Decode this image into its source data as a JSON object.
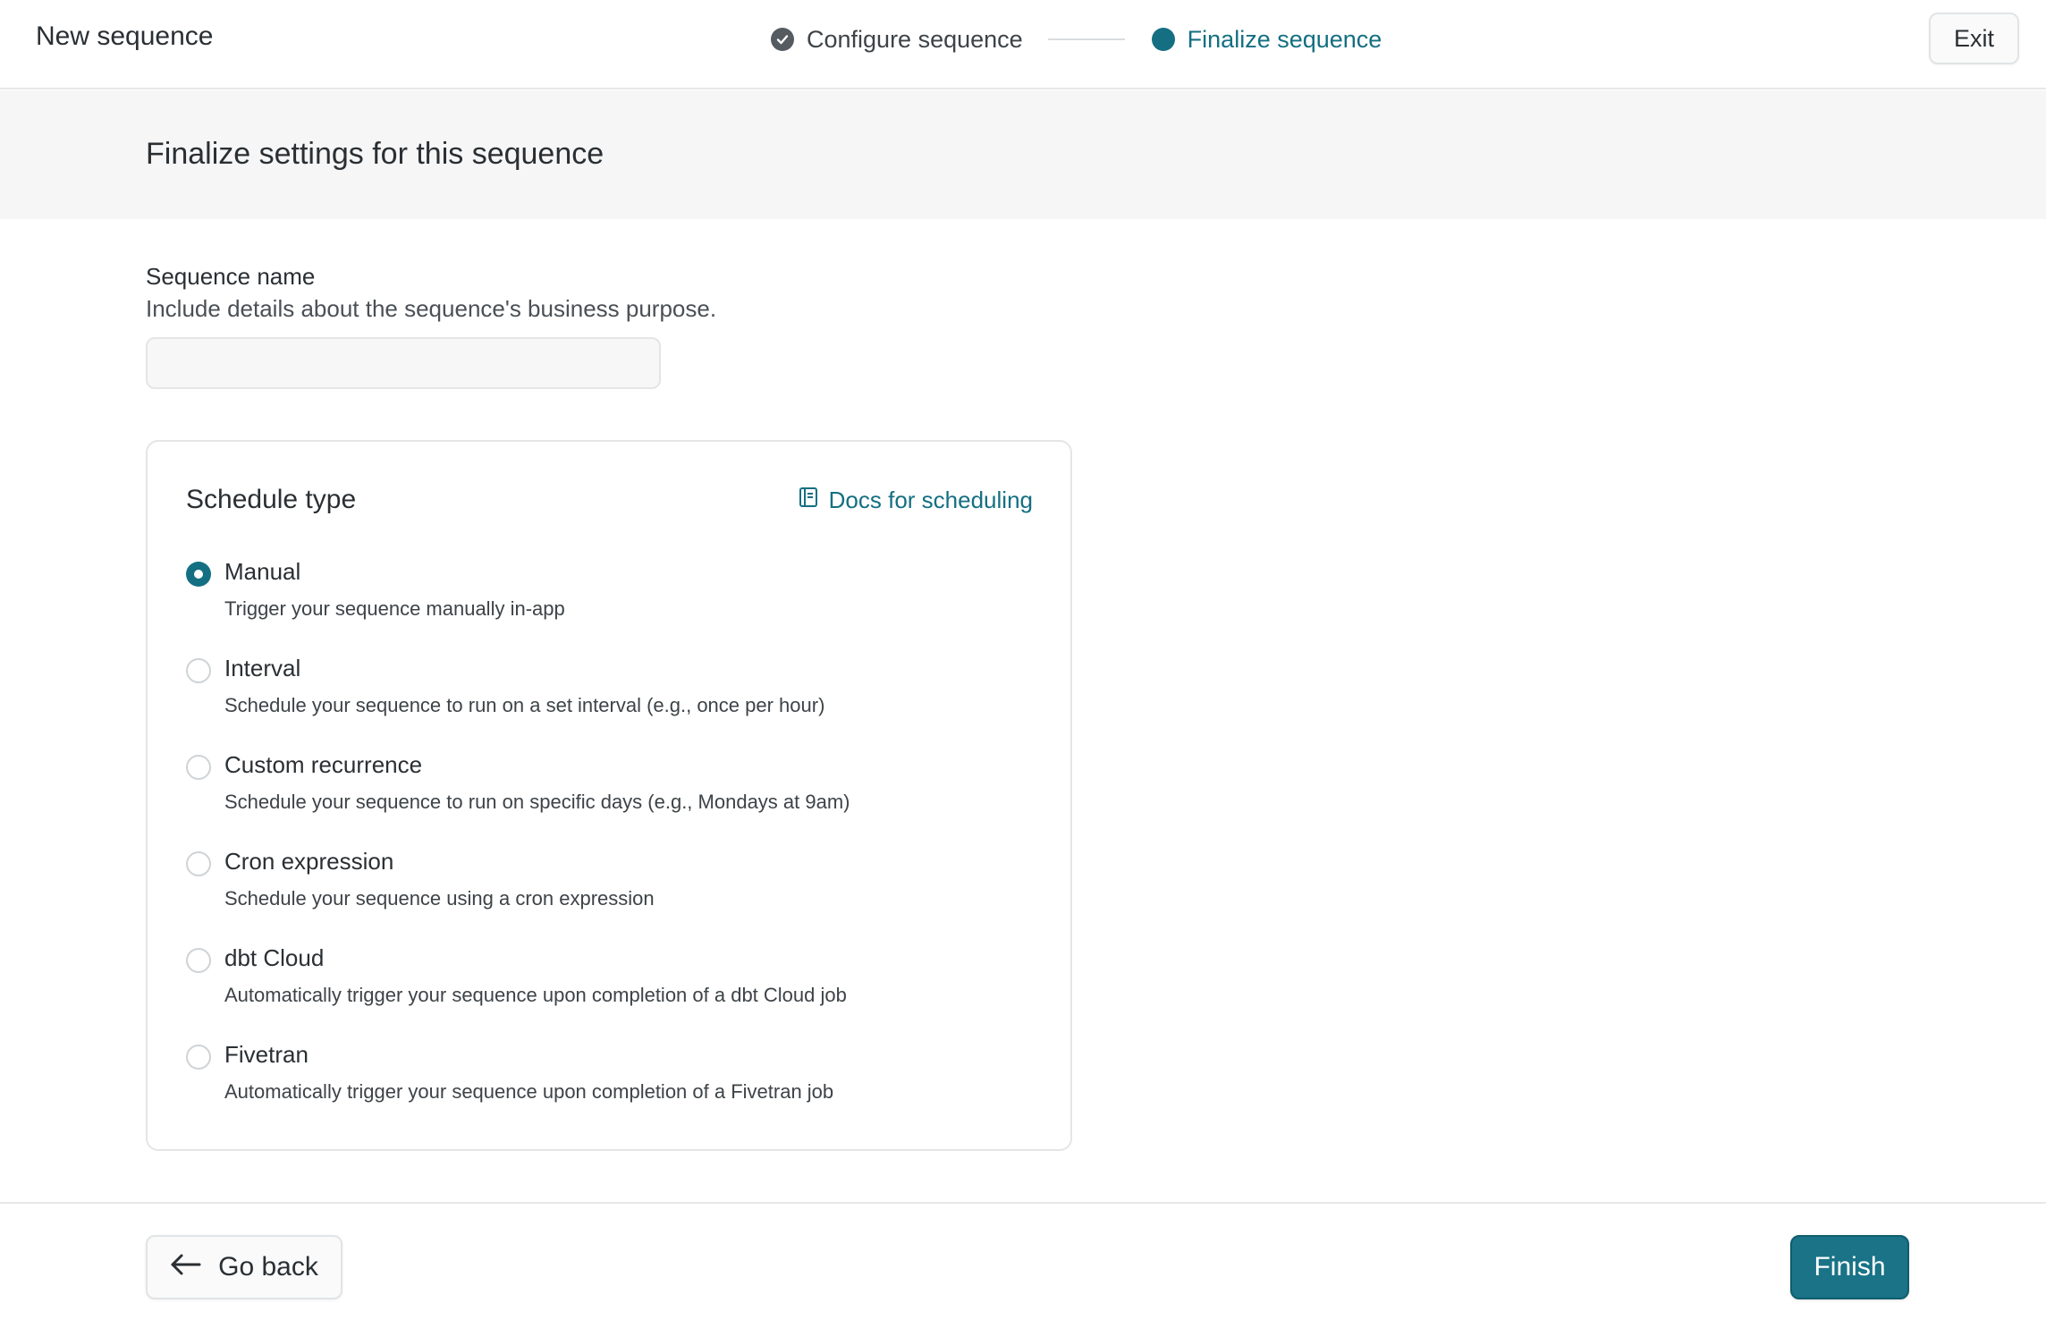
{
  "header": {
    "app_title": "New sequence",
    "steps": [
      {
        "label": "Configure sequence",
        "state": "complete"
      },
      {
        "label": "Finalize sequence",
        "state": "active"
      }
    ],
    "exit_label": "Exit"
  },
  "page": {
    "title": "Finalize settings for this sequence"
  },
  "name_field": {
    "label": "Sequence name",
    "help": "Include details about the sequence's business purpose.",
    "value": "",
    "placeholder": ""
  },
  "schedule": {
    "title": "Schedule type",
    "docs_label": "Docs for scheduling",
    "docs_icon": "book-icon",
    "selected": "Manual",
    "options": [
      {
        "label": "Manual",
        "description": "Trigger your sequence manually in-app"
      },
      {
        "label": "Interval",
        "description": "Schedule your sequence to run on a set interval (e.g., once per hour)"
      },
      {
        "label": "Custom recurrence",
        "description": "Schedule your sequence to run on specific days (e.g., Mondays at 9am)"
      },
      {
        "label": "Cron expression",
        "description": "Schedule your sequence using a cron expression"
      },
      {
        "label": "dbt Cloud",
        "description": "Automatically trigger your sequence upon completion of a dbt Cloud job"
      },
      {
        "label": "Fivetran",
        "description": "Automatically trigger your sequence upon completion of a Fivetran job"
      }
    ]
  },
  "footer": {
    "back_label": "Go back",
    "back_icon": "arrow-left-icon",
    "finish_label": "Finish"
  },
  "colors": {
    "accent": "#146f82",
    "primary_button": "#1a7387",
    "band_background": "#f6f6f6"
  }
}
